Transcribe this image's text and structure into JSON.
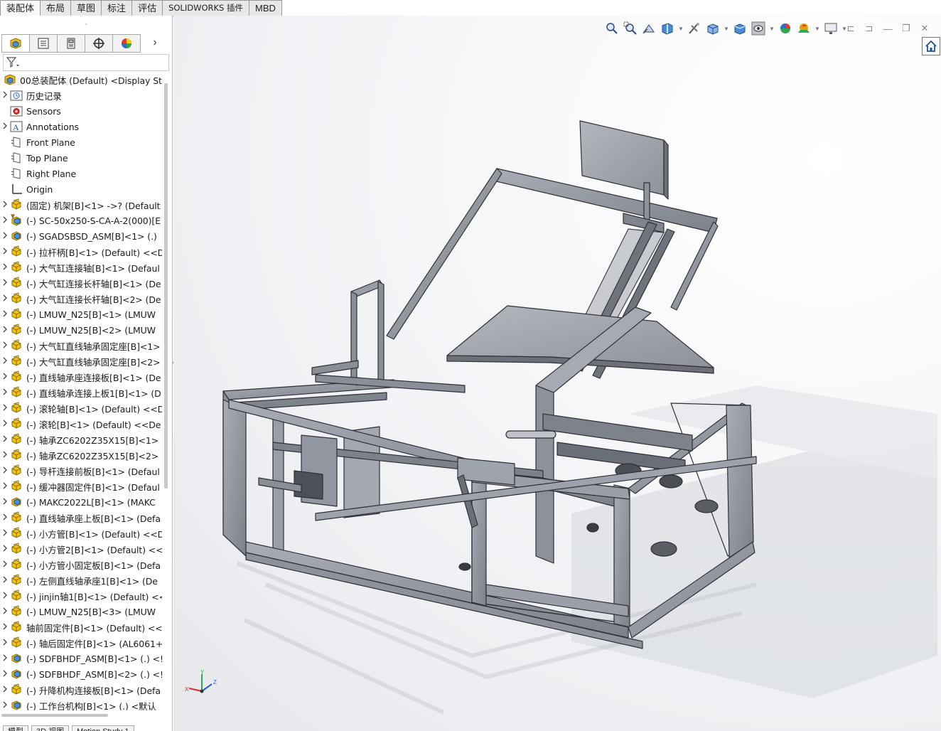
{
  "command_tabs": [
    "装配体",
    "布局",
    "草图",
    "标注",
    "评估",
    "SOLIDWORKS 插件",
    "MBD"
  ],
  "panel_tabs": [
    "FeatureManager",
    "PropertyManager",
    "ConfigurationManager",
    "DimXpertManager",
    "DisplayManager"
  ],
  "panel_grip": "◦",
  "more_symbol": "›",
  "tree": {
    "root": "00总装配体 (Default) <Display Stat",
    "items": [
      {
        "label": "历史记录",
        "icon": "history-icon",
        "expand": true
      },
      {
        "label": "Sensors",
        "icon": "sensors-icon",
        "expand": false
      },
      {
        "label": "Annotations",
        "icon": "annotations-icon",
        "expand": true
      },
      {
        "label": "Front Plane",
        "icon": "plane-icon",
        "expand": false
      },
      {
        "label": "Top Plane",
        "icon": "plane-icon",
        "expand": false
      },
      {
        "label": "Right Plane",
        "icon": "plane-icon",
        "expand": false
      },
      {
        "label": "Origin",
        "icon": "origin-icon",
        "expand": false
      },
      {
        "label": "(固定) 机架[B]<1> ->? (Default",
        "icon": "part-icon",
        "expand": true
      },
      {
        "label": "(-) SC-50x250-S-CA-A-2(000)[E",
        "icon": "subassembly-warning-icon",
        "expand": true
      },
      {
        "label": "(-) SGADSBSD_ASM[B]<1> (.)",
        "icon": "subassembly-icon",
        "expand": true
      },
      {
        "label": "(-) 拉杆柄[B]<1> (Default) <<D",
        "icon": "part-icon",
        "expand": true
      },
      {
        "label": "(-) 大气缸连接轴[B]<1> (Defaul",
        "icon": "part-icon",
        "expand": true
      },
      {
        "label": "(-) 大气缸连接长杆轴[B]<1> (De",
        "icon": "part-icon",
        "expand": true
      },
      {
        "label": "(-) 大气缸连接长杆轴[B]<2> (De",
        "icon": "part-icon",
        "expand": true
      },
      {
        "label": "(-) LMUW_N25[B]<1> (LMUW",
        "icon": "part-icon",
        "expand": true
      },
      {
        "label": "(-) LMUW_N25[B]<2> (LMUW",
        "icon": "part-icon",
        "expand": true
      },
      {
        "label": "(-) 大气缸直线轴承固定座[B]<1>",
        "icon": "part-icon",
        "expand": true
      },
      {
        "label": "(-) 大气缸直线轴承固定座[B]<2>",
        "icon": "part-icon",
        "expand": true
      },
      {
        "label": "(-) 直线轴承座连接板[B]<1> (De",
        "icon": "part-icon",
        "expand": true
      },
      {
        "label": "(-) 直线轴承连接上板1[B]<1> (D",
        "icon": "part-icon",
        "expand": true
      },
      {
        "label": "(-) 滚轮轴[B]<1> (Default) <<D",
        "icon": "part-icon",
        "expand": true
      },
      {
        "label": "(-) 滚轮[B]<1> (Default) <<De",
        "icon": "part-icon",
        "expand": true
      },
      {
        "label": "(-) 轴承ZC6202Z35X15[B]<1> (",
        "icon": "part-icon",
        "expand": true
      },
      {
        "label": "(-) 轴承ZC6202Z35X15[B]<2> (",
        "icon": "part-icon",
        "expand": true
      },
      {
        "label": "(-) 导杆连接前板[B]<1> (Defaul",
        "icon": "part-icon",
        "expand": true
      },
      {
        "label": "(-) 缓冲器固定件[B]<1> (Defaul",
        "icon": "part-icon",
        "expand": true
      },
      {
        "label": "(-) MAKC2022L[B]<1> (MAKC",
        "icon": "subassembly-icon",
        "expand": true
      },
      {
        "label": "(-) 直线轴承座上板[B]<1> (Defa",
        "icon": "part-icon",
        "expand": true
      },
      {
        "label": "(-) 小方管[B]<1> (Default) <<D",
        "icon": "part-icon",
        "expand": true
      },
      {
        "label": "(-) 小方管2[B]<1> (Default) <<",
        "icon": "part-icon",
        "expand": true
      },
      {
        "label": "(-) 小方管小固定板[B]<1> (Defa",
        "icon": "part-icon",
        "expand": true
      },
      {
        "label": "(-) 左侧直线轴承座1[B]<1> (De",
        "icon": "part-icon",
        "expand": true
      },
      {
        "label": "(-) jinjin轴1[B]<1> (Default) <<",
        "icon": "part-icon",
        "expand": true
      },
      {
        "label": "(-) LMUW_N25[B]<3> (LMUW",
        "icon": "part-icon",
        "expand": true
      },
      {
        "label": "轴前固定件[B]<1> (Default) <<",
        "icon": "part-icon",
        "expand": true
      },
      {
        "label": "(-) 轴后固定件[B]<1> (AL6061+",
        "icon": "part-icon",
        "expand": true
      },
      {
        "label": "(-) SDFBHDF_ASM[B]<1> (.) <!",
        "icon": "subassembly-icon",
        "expand": true
      },
      {
        "label": "(-) SDFBHDF_ASM[B]<2> (.) <!",
        "icon": "subassembly-icon",
        "expand": true
      },
      {
        "label": "(-) 升降机构连接板[B]<1> (Defa",
        "icon": "part-icon",
        "expand": true
      },
      {
        "label": "(-) 工作台机构[B]<1> (.) <默认_",
        "icon": "subassembly-icon",
        "expand": true
      }
    ]
  },
  "bottom_tabs": [
    "模型",
    "3D 视图",
    "Motion Study 1"
  ],
  "view_toolbar": [
    "zoom-to-fit-icon",
    "zoom-to-area-icon",
    "previous-view-icon",
    "section-view-icon",
    "dynamic-annotation-icon",
    "view-orientation-icon",
    "display-style-icon",
    "hide-show-items-icon",
    "edit-appearance-icon",
    "apply-scene-icon",
    "view-settings-icon"
  ],
  "window_controls": [
    "⊏",
    "⊐",
    "—",
    "❐",
    "✕"
  ],
  "triad": {
    "x": "X",
    "y": "Y",
    "z": "Z"
  },
  "colors": {
    "part_yellow": "#f2c21a",
    "assembly_blue": "#4a8fd6",
    "model_gray": "#8f939c",
    "model_dark": "#3a3c42"
  }
}
